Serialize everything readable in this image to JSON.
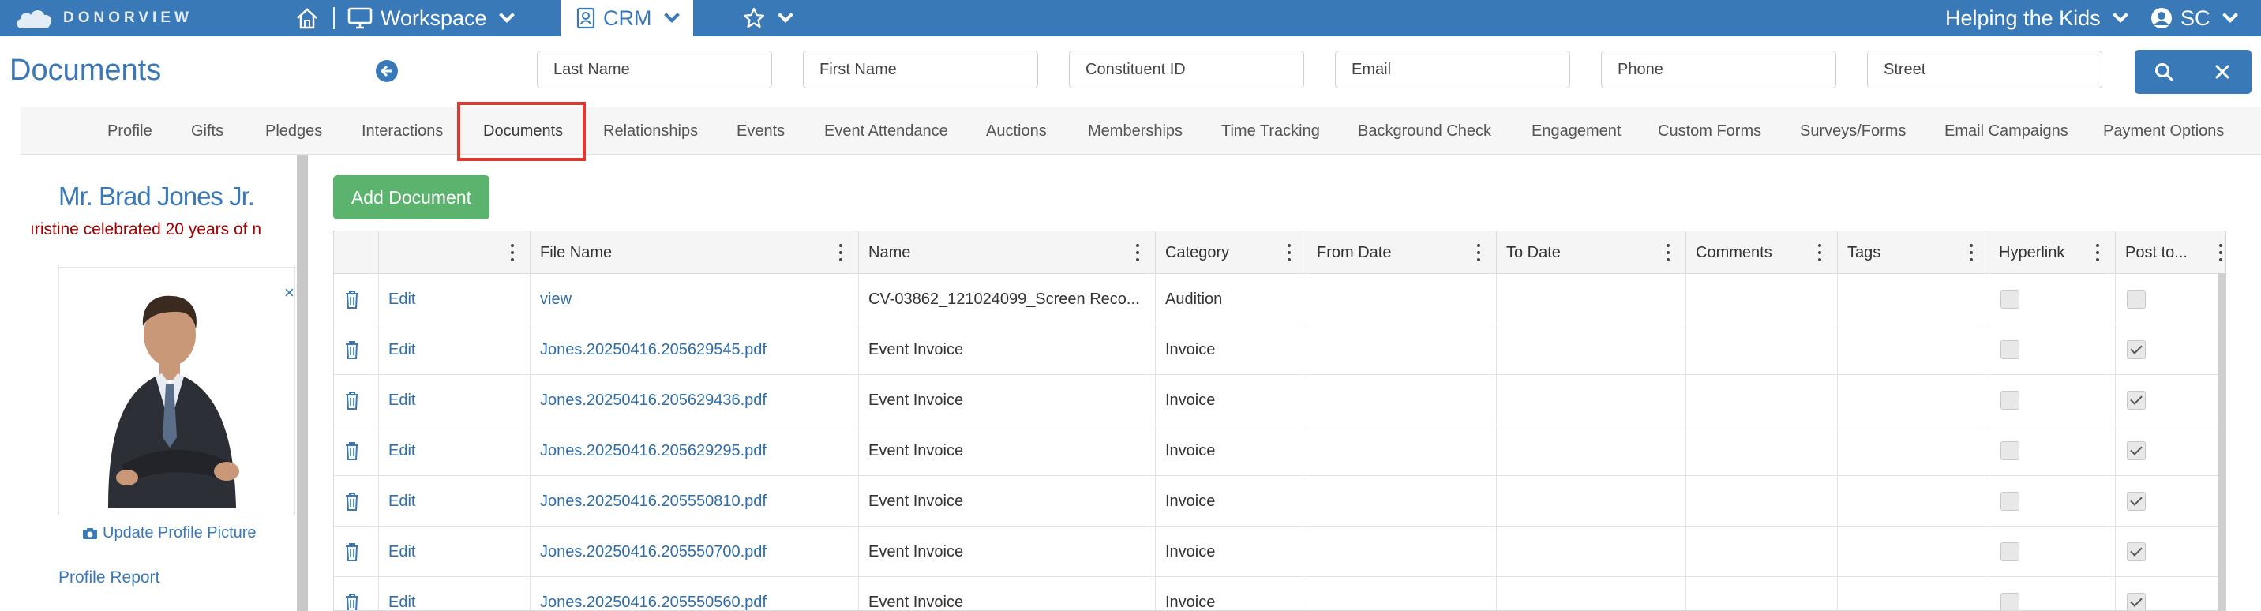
{
  "topnav": {
    "logo_text": "DONORVIEW",
    "workspace_label": "Workspace",
    "crm_label": "CRM",
    "org_label": "Helping the Kids",
    "user_initials": "SC",
    "bg_color": "#3a79b8"
  },
  "header": {
    "title": "Documents",
    "search": {
      "last_name": "Last Name",
      "first_name": "First Name",
      "constituent_id": "Constituent ID",
      "email": "Email",
      "phone": "Phone",
      "street": "Street"
    }
  },
  "tabs": [
    "Profile",
    "Gifts",
    "Pledges",
    "Interactions",
    "Documents",
    "Relationships",
    "Events",
    "Event Attendance",
    "Auctions",
    "Memberships",
    "Time Tracking",
    "Background Check",
    "Engagement",
    "Custom Forms",
    "Surveys/Forms",
    "Email Campaigns",
    "Payment Options"
  ],
  "active_tab": "Documents",
  "sidebar": {
    "name": "Mr. Brad Jones Jr.",
    "banner": "ıristine celebrated 20 years of n",
    "update_picture": "Update Profile Picture",
    "profile_report": "Profile Report",
    "close_glyph": "×"
  },
  "main": {
    "add_button": "Add Document",
    "columns": [
      "File Name",
      "Name",
      "Category",
      "From Date",
      "To Date",
      "Comments",
      "Tags",
      "Hyperlink",
      "Post to..."
    ],
    "edit_label": "Edit",
    "rows": [
      {
        "file": "view",
        "name": "CV-03862_121024099_Screen Reco...",
        "category": "Audition",
        "hyperlink": false,
        "post": false
      },
      {
        "file": "Jones.20250416.205629545.pdf",
        "name": "Event Invoice",
        "category": "Invoice",
        "hyperlink": false,
        "post": true
      },
      {
        "file": "Jones.20250416.205629436.pdf",
        "name": "Event Invoice",
        "category": "Invoice",
        "hyperlink": false,
        "post": true
      },
      {
        "file": "Jones.20250416.205629295.pdf",
        "name": "Event Invoice",
        "category": "Invoice",
        "hyperlink": false,
        "post": true
      },
      {
        "file": "Jones.20250416.205550810.pdf",
        "name": "Event Invoice",
        "category": "Invoice",
        "hyperlink": false,
        "post": true
      },
      {
        "file": "Jones.20250416.205550700.pdf",
        "name": "Event Invoice",
        "category": "Invoice",
        "hyperlink": false,
        "post": true
      },
      {
        "file": "Jones.20250416.205550560.pdf",
        "name": "Event Invoice",
        "category": "Invoice",
        "hyperlink": false,
        "post": true
      }
    ]
  }
}
